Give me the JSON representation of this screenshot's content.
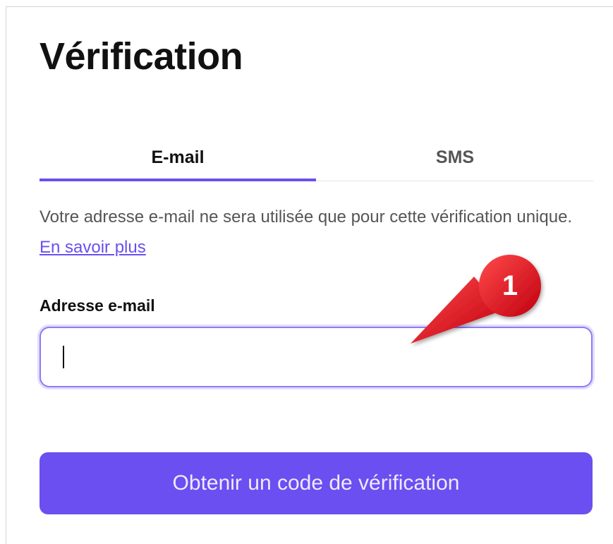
{
  "title": "Vérification",
  "tabs": [
    {
      "label": "E-mail",
      "active": true
    },
    {
      "label": "SMS",
      "active": false
    }
  ],
  "description": {
    "text": "Votre adresse e-mail ne sera utilisée que pour cette vérification unique. ",
    "link": "En savoir plus"
  },
  "email": {
    "label": "Adresse e-mail",
    "value": "",
    "placeholder": ""
  },
  "submit_label": "Obtenir un code de vérification",
  "annotation": {
    "number": "1"
  },
  "colors": {
    "accent": "#6b4ff0",
    "annotation": "#e0161c"
  }
}
